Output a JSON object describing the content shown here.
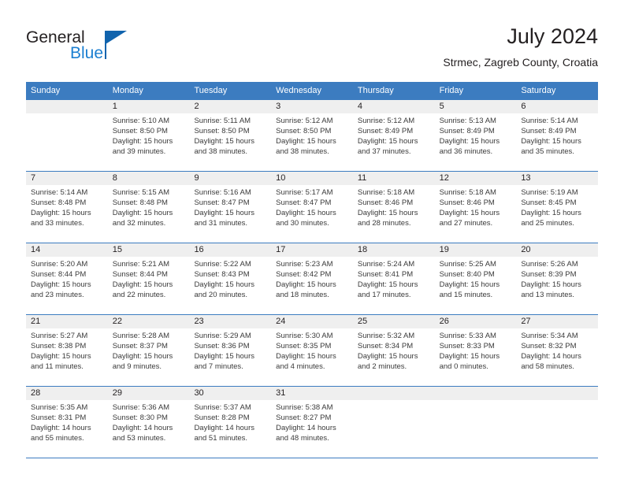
{
  "brand": {
    "name_part1": "General",
    "name_part2": "Blue",
    "flag_color": "#1063ad",
    "accent_color": "#1b7fd1"
  },
  "header": {
    "title": "July 2024",
    "subtitle": "Strmec, Zagreb County, Croatia"
  },
  "theme": {
    "header_bg": "#3c7cc0",
    "daynum_bg": "#efefef",
    "rule_color": "#3c7cc0",
    "text_color": "#231f20",
    "cell_text_color": "#3a3a3a"
  },
  "weekdays": [
    "Sunday",
    "Monday",
    "Tuesday",
    "Wednesday",
    "Thursday",
    "Friday",
    "Saturday"
  ],
  "weeks": [
    {
      "days": [
        {
          "num": "",
          "sunrise": "",
          "sunset": "",
          "daylight1": "",
          "daylight2": "",
          "empty": true
        },
        {
          "num": "1",
          "sunrise": "Sunrise: 5:10 AM",
          "sunset": "Sunset: 8:50 PM",
          "daylight1": "Daylight: 15 hours",
          "daylight2": "and 39 minutes.",
          "empty": false
        },
        {
          "num": "2",
          "sunrise": "Sunrise: 5:11 AM",
          "sunset": "Sunset: 8:50 PM",
          "daylight1": "Daylight: 15 hours",
          "daylight2": "and 38 minutes.",
          "empty": false
        },
        {
          "num": "3",
          "sunrise": "Sunrise: 5:12 AM",
          "sunset": "Sunset: 8:50 PM",
          "daylight1": "Daylight: 15 hours",
          "daylight2": "and 38 minutes.",
          "empty": false
        },
        {
          "num": "4",
          "sunrise": "Sunrise: 5:12 AM",
          "sunset": "Sunset: 8:49 PM",
          "daylight1": "Daylight: 15 hours",
          "daylight2": "and 37 minutes.",
          "empty": false
        },
        {
          "num": "5",
          "sunrise": "Sunrise: 5:13 AM",
          "sunset": "Sunset: 8:49 PM",
          "daylight1": "Daylight: 15 hours",
          "daylight2": "and 36 minutes.",
          "empty": false
        },
        {
          "num": "6",
          "sunrise": "Sunrise: 5:14 AM",
          "sunset": "Sunset: 8:49 PM",
          "daylight1": "Daylight: 15 hours",
          "daylight2": "and 35 minutes.",
          "empty": false
        }
      ]
    },
    {
      "days": [
        {
          "num": "7",
          "sunrise": "Sunrise: 5:14 AM",
          "sunset": "Sunset: 8:48 PM",
          "daylight1": "Daylight: 15 hours",
          "daylight2": "and 33 minutes.",
          "empty": false
        },
        {
          "num": "8",
          "sunrise": "Sunrise: 5:15 AM",
          "sunset": "Sunset: 8:48 PM",
          "daylight1": "Daylight: 15 hours",
          "daylight2": "and 32 minutes.",
          "empty": false
        },
        {
          "num": "9",
          "sunrise": "Sunrise: 5:16 AM",
          "sunset": "Sunset: 8:47 PM",
          "daylight1": "Daylight: 15 hours",
          "daylight2": "and 31 minutes.",
          "empty": false
        },
        {
          "num": "10",
          "sunrise": "Sunrise: 5:17 AM",
          "sunset": "Sunset: 8:47 PM",
          "daylight1": "Daylight: 15 hours",
          "daylight2": "and 30 minutes.",
          "empty": false
        },
        {
          "num": "11",
          "sunrise": "Sunrise: 5:18 AM",
          "sunset": "Sunset: 8:46 PM",
          "daylight1": "Daylight: 15 hours",
          "daylight2": "and 28 minutes.",
          "empty": false
        },
        {
          "num": "12",
          "sunrise": "Sunrise: 5:18 AM",
          "sunset": "Sunset: 8:46 PM",
          "daylight1": "Daylight: 15 hours",
          "daylight2": "and 27 minutes.",
          "empty": false
        },
        {
          "num": "13",
          "sunrise": "Sunrise: 5:19 AM",
          "sunset": "Sunset: 8:45 PM",
          "daylight1": "Daylight: 15 hours",
          "daylight2": "and 25 minutes.",
          "empty": false
        }
      ]
    },
    {
      "days": [
        {
          "num": "14",
          "sunrise": "Sunrise: 5:20 AM",
          "sunset": "Sunset: 8:44 PM",
          "daylight1": "Daylight: 15 hours",
          "daylight2": "and 23 minutes.",
          "empty": false
        },
        {
          "num": "15",
          "sunrise": "Sunrise: 5:21 AM",
          "sunset": "Sunset: 8:44 PM",
          "daylight1": "Daylight: 15 hours",
          "daylight2": "and 22 minutes.",
          "empty": false
        },
        {
          "num": "16",
          "sunrise": "Sunrise: 5:22 AM",
          "sunset": "Sunset: 8:43 PM",
          "daylight1": "Daylight: 15 hours",
          "daylight2": "and 20 minutes.",
          "empty": false
        },
        {
          "num": "17",
          "sunrise": "Sunrise: 5:23 AM",
          "sunset": "Sunset: 8:42 PM",
          "daylight1": "Daylight: 15 hours",
          "daylight2": "and 18 minutes.",
          "empty": false
        },
        {
          "num": "18",
          "sunrise": "Sunrise: 5:24 AM",
          "sunset": "Sunset: 8:41 PM",
          "daylight1": "Daylight: 15 hours",
          "daylight2": "and 17 minutes.",
          "empty": false
        },
        {
          "num": "19",
          "sunrise": "Sunrise: 5:25 AM",
          "sunset": "Sunset: 8:40 PM",
          "daylight1": "Daylight: 15 hours",
          "daylight2": "and 15 minutes.",
          "empty": false
        },
        {
          "num": "20",
          "sunrise": "Sunrise: 5:26 AM",
          "sunset": "Sunset: 8:39 PM",
          "daylight1": "Daylight: 15 hours",
          "daylight2": "and 13 minutes.",
          "empty": false
        }
      ]
    },
    {
      "days": [
        {
          "num": "21",
          "sunrise": "Sunrise: 5:27 AM",
          "sunset": "Sunset: 8:38 PM",
          "daylight1": "Daylight: 15 hours",
          "daylight2": "and 11 minutes.",
          "empty": false
        },
        {
          "num": "22",
          "sunrise": "Sunrise: 5:28 AM",
          "sunset": "Sunset: 8:37 PM",
          "daylight1": "Daylight: 15 hours",
          "daylight2": "and 9 minutes.",
          "empty": false
        },
        {
          "num": "23",
          "sunrise": "Sunrise: 5:29 AM",
          "sunset": "Sunset: 8:36 PM",
          "daylight1": "Daylight: 15 hours",
          "daylight2": "and 7 minutes.",
          "empty": false
        },
        {
          "num": "24",
          "sunrise": "Sunrise: 5:30 AM",
          "sunset": "Sunset: 8:35 PM",
          "daylight1": "Daylight: 15 hours",
          "daylight2": "and 4 minutes.",
          "empty": false
        },
        {
          "num": "25",
          "sunrise": "Sunrise: 5:32 AM",
          "sunset": "Sunset: 8:34 PM",
          "daylight1": "Daylight: 15 hours",
          "daylight2": "and 2 minutes.",
          "empty": false
        },
        {
          "num": "26",
          "sunrise": "Sunrise: 5:33 AM",
          "sunset": "Sunset: 8:33 PM",
          "daylight1": "Daylight: 15 hours",
          "daylight2": "and 0 minutes.",
          "empty": false
        },
        {
          "num": "27",
          "sunrise": "Sunrise: 5:34 AM",
          "sunset": "Sunset: 8:32 PM",
          "daylight1": "Daylight: 14 hours",
          "daylight2": "and 58 minutes.",
          "empty": false
        }
      ]
    },
    {
      "days": [
        {
          "num": "28",
          "sunrise": "Sunrise: 5:35 AM",
          "sunset": "Sunset: 8:31 PM",
          "daylight1": "Daylight: 14 hours",
          "daylight2": "and 55 minutes.",
          "empty": false
        },
        {
          "num": "29",
          "sunrise": "Sunrise: 5:36 AM",
          "sunset": "Sunset: 8:30 PM",
          "daylight1": "Daylight: 14 hours",
          "daylight2": "and 53 minutes.",
          "empty": false
        },
        {
          "num": "30",
          "sunrise": "Sunrise: 5:37 AM",
          "sunset": "Sunset: 8:28 PM",
          "daylight1": "Daylight: 14 hours",
          "daylight2": "and 51 minutes.",
          "empty": false
        },
        {
          "num": "31",
          "sunrise": "Sunrise: 5:38 AM",
          "sunset": "Sunset: 8:27 PM",
          "daylight1": "Daylight: 14 hours",
          "daylight2": "and 48 minutes.",
          "empty": false
        },
        {
          "num": "",
          "sunrise": "",
          "sunset": "",
          "daylight1": "",
          "daylight2": "",
          "empty": true
        },
        {
          "num": "",
          "sunrise": "",
          "sunset": "",
          "daylight1": "",
          "daylight2": "",
          "empty": true
        },
        {
          "num": "",
          "sunrise": "",
          "sunset": "",
          "daylight1": "",
          "daylight2": "",
          "empty": true
        }
      ]
    }
  ]
}
